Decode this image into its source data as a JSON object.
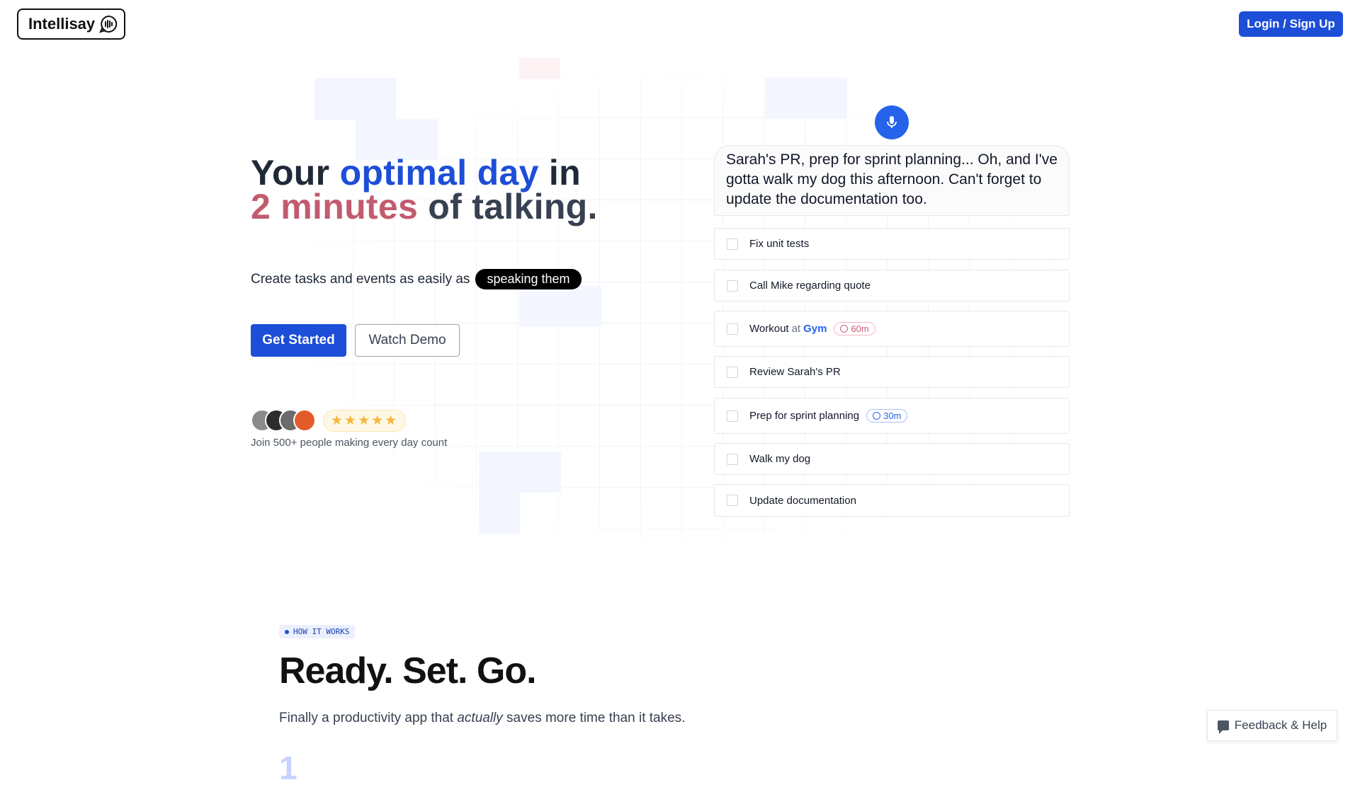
{
  "header": {
    "logo_text": "Intellisay",
    "login_label": "Login / Sign Up"
  },
  "hero": {
    "title_part1": "Your ",
    "title_highlight1": "optimal day",
    "title_part2": " in",
    "title_highlight2": "2 minutes",
    "title_part3": " of talking.",
    "subtitle_text": "Create tasks and events as easily as",
    "subtitle_pill": "speaking them",
    "get_started_label": "Get Started",
    "watch_demo_label": "Watch Demo",
    "rating_stars": "★★★★★",
    "social_text": "Join 500+ people making every day count"
  },
  "demo": {
    "transcript": "Sarah's PR, prep for sprint planning... Oh, and I've gotta walk my dog this afternoon. Can't forget to update the documentation too.",
    "tasks": [
      {
        "label": "Fix unit tests"
      },
      {
        "label": "Call Mike regarding quote"
      },
      {
        "label": "Workout",
        "at": "at",
        "location": "Gym",
        "duration": "60m"
      },
      {
        "label": "Review Sarah's PR"
      },
      {
        "label": "Prep for sprint planning",
        "duration": "30m"
      },
      {
        "label": "Walk my dog"
      },
      {
        "label": "Update documentation"
      }
    ]
  },
  "how_it_works": {
    "tag": "HOW IT WORKS",
    "title": "Ready. Set. Go.",
    "subtitle_before": "Finally a productivity app that ",
    "subtitle_emphasis": "actually",
    "subtitle_after": " saves more time than it takes.",
    "step_number": "1"
  },
  "feedback": {
    "label": "Feedback & Help"
  },
  "colors": {
    "primary": "#1d4ed8",
    "accent_red": "#c25b6e"
  }
}
